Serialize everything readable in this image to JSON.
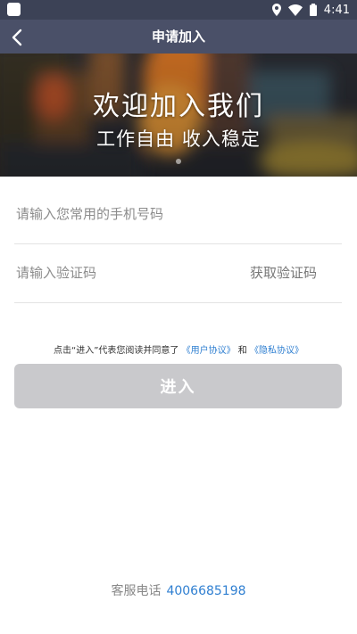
{
  "status_bar": {
    "time": "4:41"
  },
  "nav": {
    "title": "申请加入"
  },
  "banner": {
    "headline": "欢迎加入我们",
    "subline": "工作自由  收入稳定"
  },
  "form": {
    "phone_placeholder": "请输入您常用的手机号码",
    "code_placeholder": "请输入验证码",
    "get_code_label": "获取验证码"
  },
  "agreement": {
    "prefix": "点击“进入”代表您阅读并同意了",
    "user_agreement": "《用户协议》",
    "and": "和",
    "privacy_agreement": "《隐私协议》"
  },
  "enter_button": {
    "label": "进入",
    "color": "#c9c9cc"
  },
  "service": {
    "label": "客服电话",
    "phone": "4006685198"
  },
  "colors": {
    "status_bar": "#3c4256",
    "nav_bar": "#4a5068",
    "link": "#2f7fd1"
  }
}
